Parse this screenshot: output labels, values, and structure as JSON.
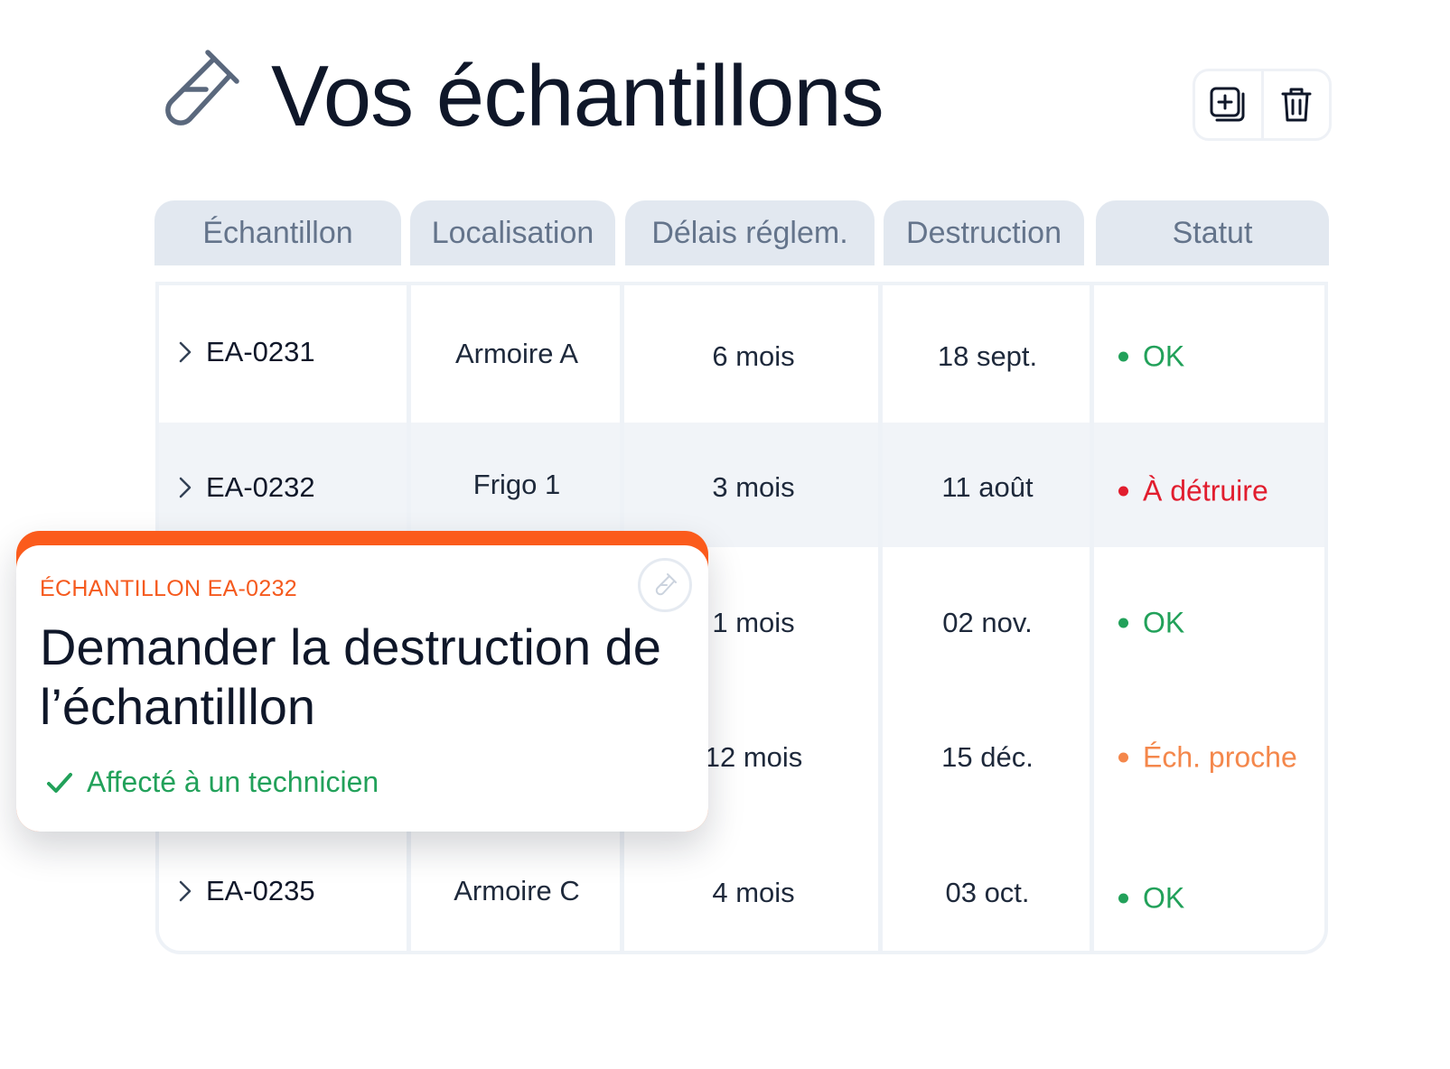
{
  "page": {
    "title": "Vos échantillons",
    "title_icon": "test-tube-icon"
  },
  "toolbar": {
    "add_icon": "add-copy-icon",
    "delete_icon": "trash-icon"
  },
  "columns": [
    {
      "label": "Échantillon",
      "active": true
    },
    {
      "label": "Localisation",
      "active": false
    },
    {
      "label": "Délais réglem.",
      "active": false
    },
    {
      "label": "Destruction",
      "active": false
    },
    {
      "label": "Statut",
      "active": false
    }
  ],
  "rows": [
    {
      "id": "EA-0231",
      "location": "Armoire A",
      "delay": "6 mois",
      "destruction": "18 sept.",
      "status": "OK",
      "status_kind": "ok"
    },
    {
      "id": "EA-0232",
      "location": "Frigo 1",
      "delay": "3 mois",
      "destruction": "11 août",
      "status": "À détruire",
      "status_kind": "danger"
    },
    {
      "id": "",
      "location": "",
      "delay": "1 mois",
      "destruction": "02 nov.",
      "status": "OK",
      "status_kind": "ok"
    },
    {
      "id": "",
      "location": "",
      "delay": "12 mois",
      "destruction": "15 déc.",
      "status": "Éch. proche",
      "status_kind": "warning"
    },
    {
      "id": "EA-0235",
      "location": "Armoire C",
      "delay": "4 mois",
      "destruction": "03 oct.",
      "status": "OK",
      "status_kind": "ok"
    }
  ],
  "status_colors": {
    "ok": "#22a15a",
    "danger": "#e11d2e",
    "warning": "#f4874b"
  },
  "popup": {
    "kicker": "ÉCHANTILLON EA-0232",
    "title": "Demander la destruction de l’échantilllon",
    "status": "Affecté à un technicien",
    "status_icon": "checkmark-icon",
    "badge_icon": "test-tube-icon",
    "accent_color": "#fb5b1c"
  }
}
